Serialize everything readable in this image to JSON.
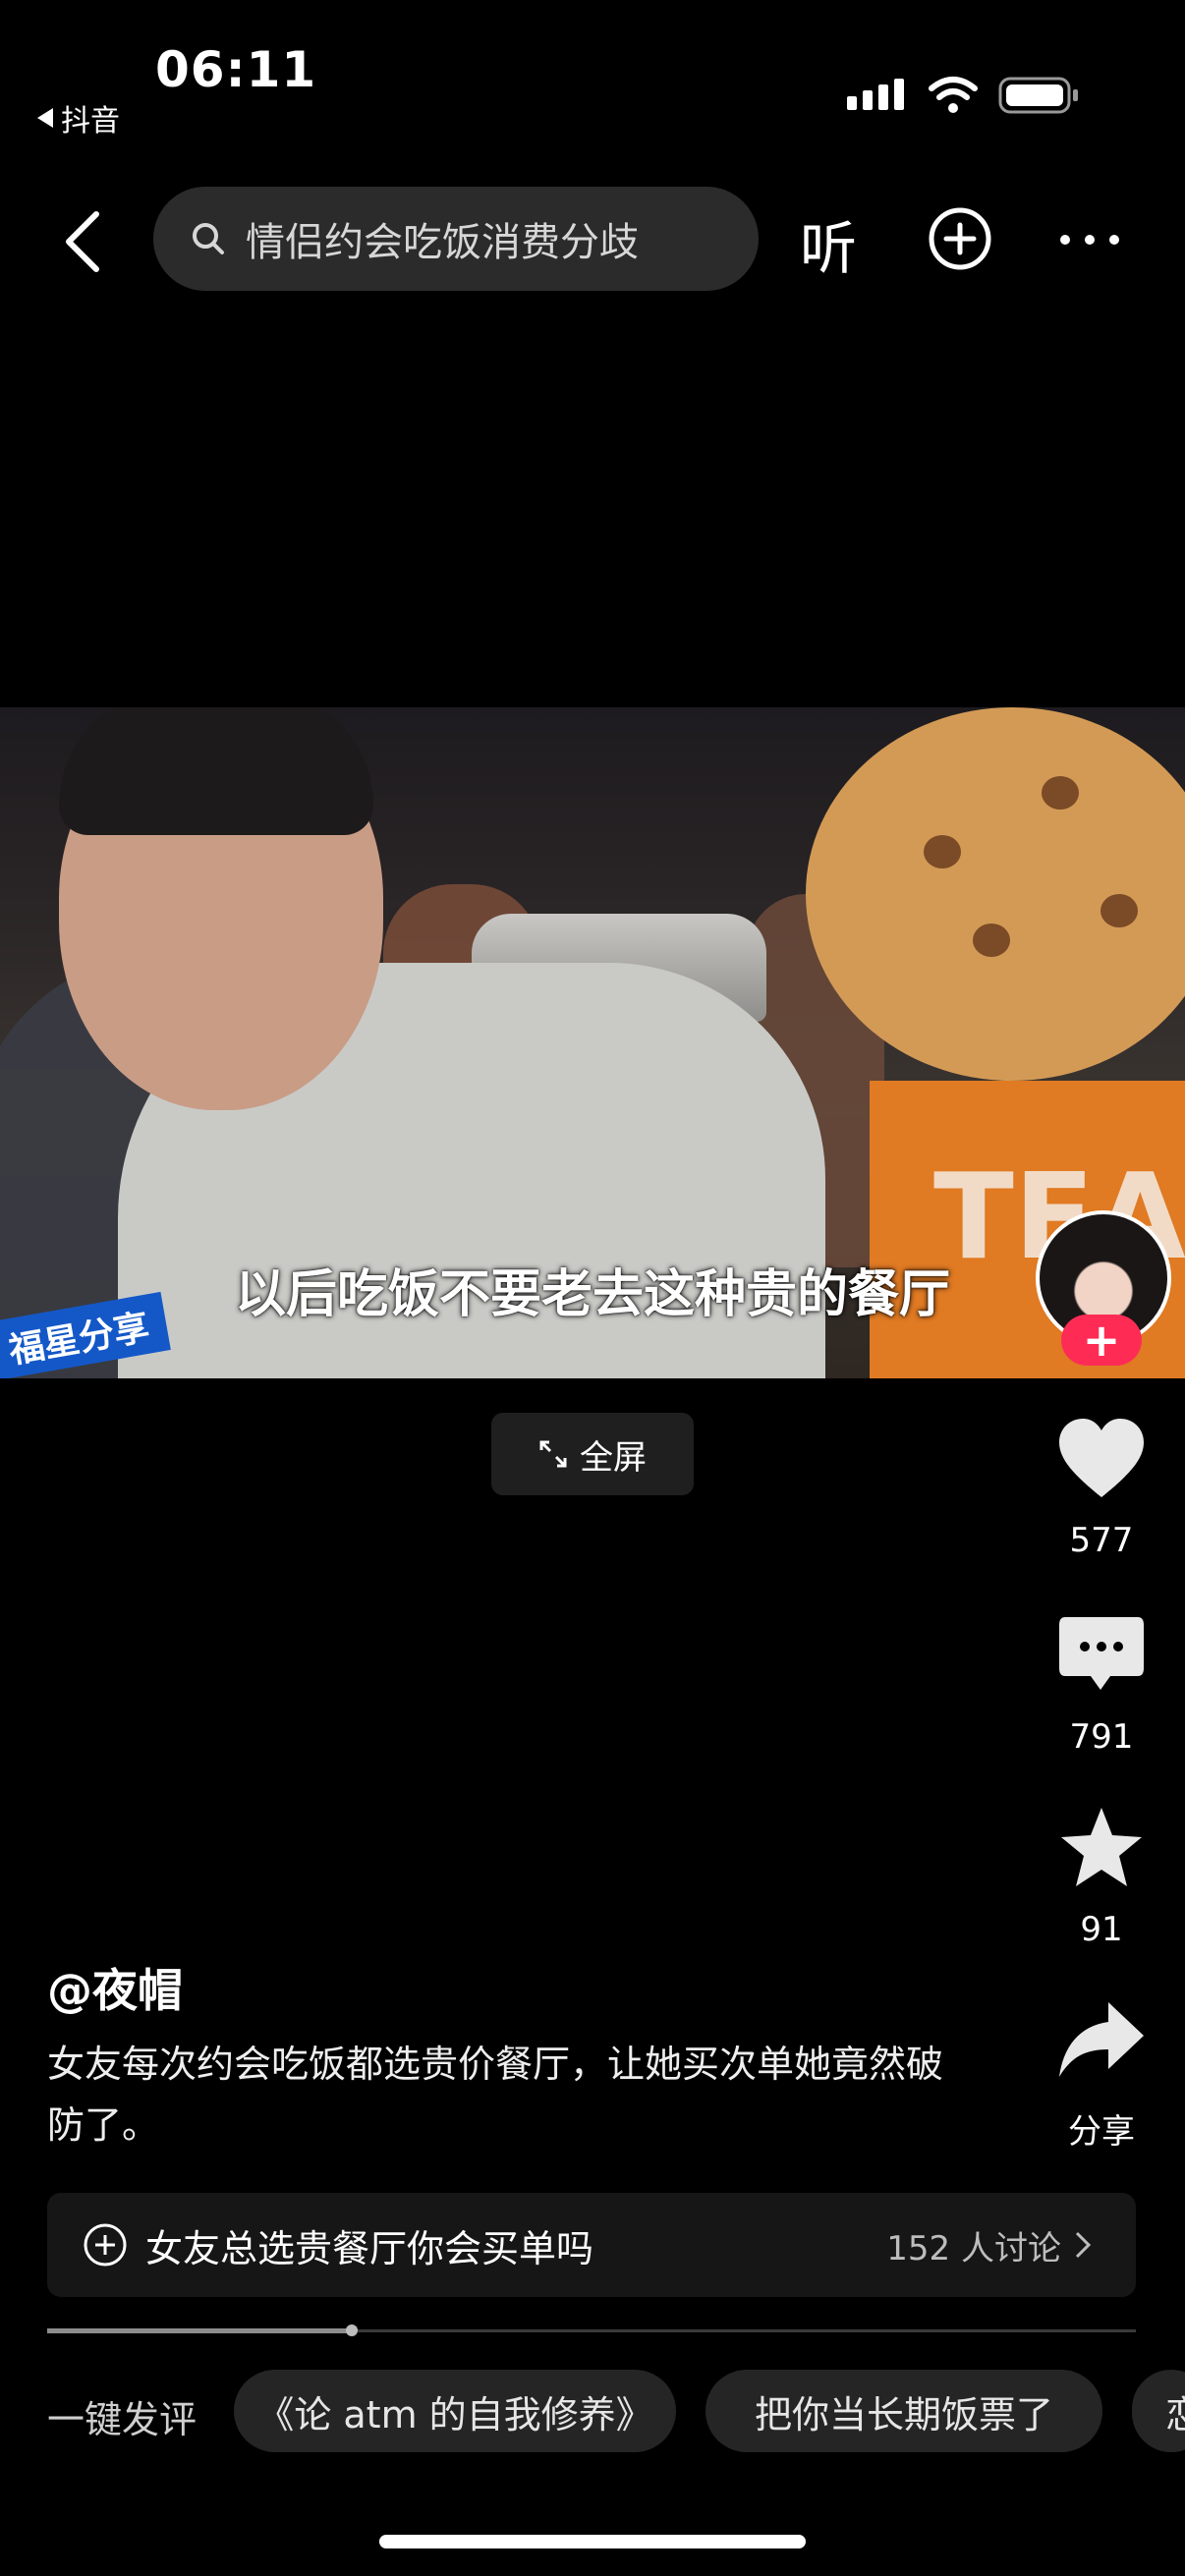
{
  "status_bar": {
    "time": "06:11",
    "back_app": "抖音"
  },
  "nav": {
    "search_text": "情侣约会吃饭消费分歧",
    "listen_label": "听"
  },
  "video": {
    "subtitle": "以后吃饭不要老去这种贵的餐厅",
    "watermark": "福星分享",
    "overlay_text": "TEA",
    "fullscreen_label": "全屏"
  },
  "actions": {
    "like_count": "577",
    "comment_count": "791",
    "favorite_count": "91",
    "share_label": "分享",
    "follow_icon": "plus-icon"
  },
  "post": {
    "author": "@夜帽",
    "description": "女友每次约会吃饭都选贵价餐厅，让她买次单她竟然破防了。"
  },
  "topic": {
    "text": "女友总选贵餐厅你会买单吗",
    "count": "152 人讨论"
  },
  "progress": 0.28,
  "quick_comment": {
    "label": "一键发评",
    "chips": [
      "《论 atm 的自我修养》",
      "把你当长期饭票了",
      "恋"
    ]
  },
  "colors": {
    "accent": "#fe2c55",
    "background": "#000000"
  }
}
